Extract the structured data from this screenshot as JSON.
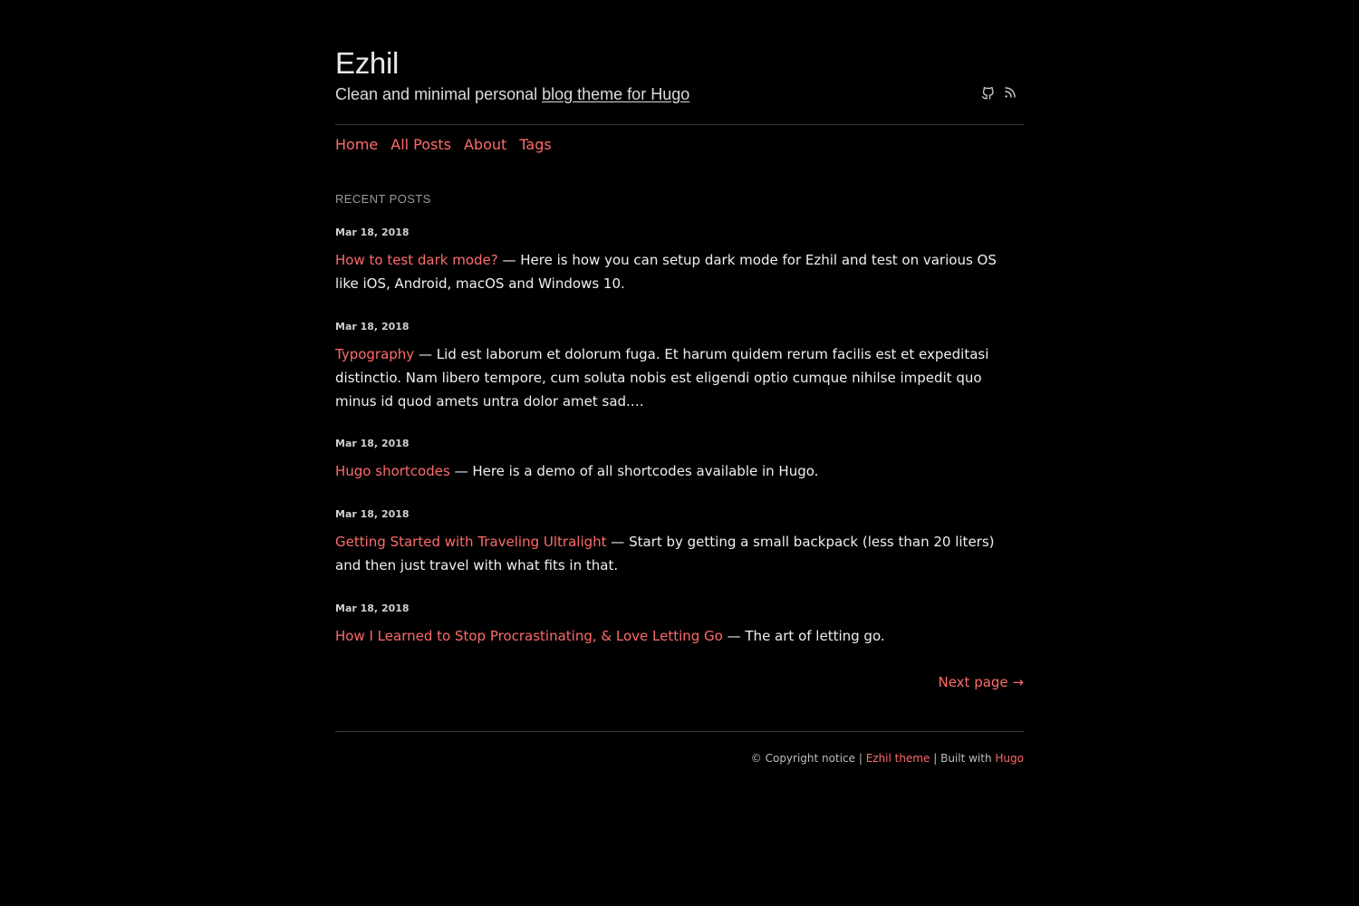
{
  "site": {
    "title": "Ezhil",
    "description_prefix": "Clean and minimal personal ",
    "description_link": "blog theme for Hugo"
  },
  "social": {
    "items": [
      {
        "icon": "github-icon"
      },
      {
        "icon": "rss-icon"
      }
    ]
  },
  "nav": {
    "items": [
      {
        "label": "Home"
      },
      {
        "label": "All Posts"
      },
      {
        "label": "About"
      },
      {
        "label": "Tags"
      }
    ]
  },
  "recent": {
    "heading": "RECENT POSTS"
  },
  "posts": [
    {
      "date": "Mar 18, 2018",
      "title": "How to test dark mode?",
      "summary": " — Here is how you can setup dark mode for Ezhil and test on various OS like iOS, Android, macOS and Windows 10."
    },
    {
      "date": "Mar 18, 2018",
      "title": "Typography",
      "summary": " — Lid est laborum et dolorum fuga. Et harum quidem rerum facilis est et expeditasi distinctio. Nam libero tempore, cum soluta nobis est eligendi optio cumque nihilse impedit quo minus id quod amets untra dolor amet sad.…"
    },
    {
      "date": "Mar 18, 2018",
      "title": "Hugo shortcodes",
      "summary": " — Here is a demo of all shortcodes available in Hugo."
    },
    {
      "date": "Mar 18, 2018",
      "title": "Getting Started with Traveling Ultralight",
      "summary": " — Start by getting a small backpack (less than 20 liters) and then just travel with what fits in that."
    },
    {
      "date": "Mar 18, 2018",
      "title": "How I Learned to Stop Procrastinating, & Love Letting Go",
      "summary": " — The art of letting go."
    }
  ],
  "pagination": {
    "next_label": "Next page →"
  },
  "footer": {
    "copyright": "© Copyright notice | ",
    "theme_link": "Ezhil theme",
    "built_with": " | Built with ",
    "hugo_link": "Hugo"
  },
  "colors": {
    "background": "#000000",
    "accent": "#ff6b6b",
    "text": "#f0f0f0",
    "muted": "#9a9a9a",
    "divider": "#3a3a3a"
  }
}
